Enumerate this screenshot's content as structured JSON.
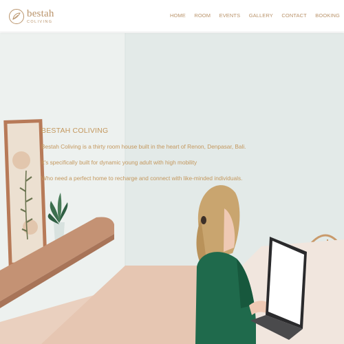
{
  "brand": {
    "name": "bestah",
    "tagline": "COLIVING"
  },
  "nav": {
    "items": [
      {
        "label": "HOME"
      },
      {
        "label": "ROOM"
      },
      {
        "label": "EVENTS"
      },
      {
        "label": "GALLERY"
      },
      {
        "label": "CONTACT"
      },
      {
        "label": "BOOKING"
      }
    ]
  },
  "hero": {
    "title": "BESTAH COLIVING",
    "lines": [
      "Bestah Coliving is a thirty room house built in the heart of Renon, Denpasar, Bali.",
      "It's specifically built for dynamic young adult with high mobility",
      "Who need a perfect home to recharge and connect with like-minded individuals."
    ]
  },
  "colors": {
    "accent": "#c3975d",
    "wall": "#e6ecea",
    "floor": "#e9cbb8",
    "shelf": "#c49274",
    "sweater": "#1f6a4c"
  }
}
